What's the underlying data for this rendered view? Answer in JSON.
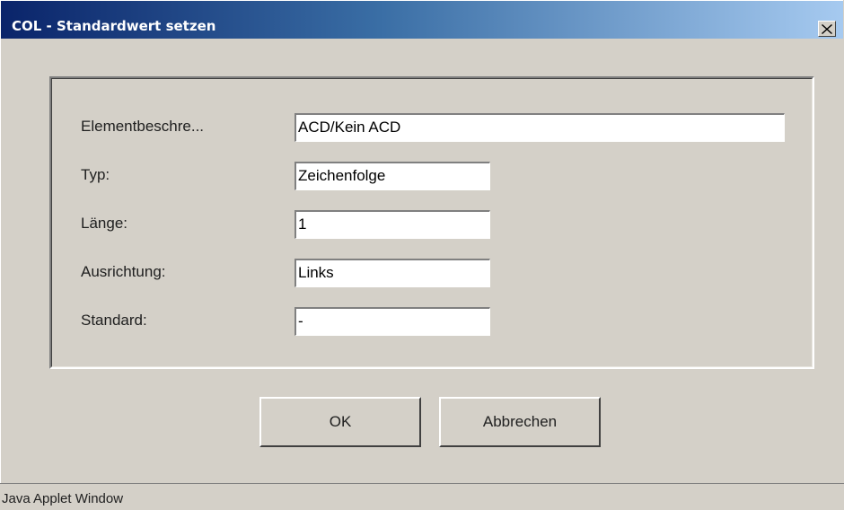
{
  "window": {
    "title": "COL - Standardwert setzen",
    "close_icon": "close-icon"
  },
  "form": {
    "rows": [
      {
        "label": "Elementbeschre...",
        "value": "ACD/Kein ACD"
      },
      {
        "label": "Typ:",
        "value": "Zeichenfolge"
      },
      {
        "label": "Länge:",
        "value": "1"
      },
      {
        "label": "Ausrichtung:",
        "value": "Links"
      },
      {
        "label": "Standard:",
        "value": "-"
      }
    ]
  },
  "buttons": {
    "ok_label": "OK",
    "cancel_label": "Abbrechen"
  },
  "status": {
    "text": "Java Applet Window"
  },
  "colors": {
    "title_start": "#0a246a",
    "title_end": "#a6caf0",
    "face": "#d4d0c8"
  }
}
